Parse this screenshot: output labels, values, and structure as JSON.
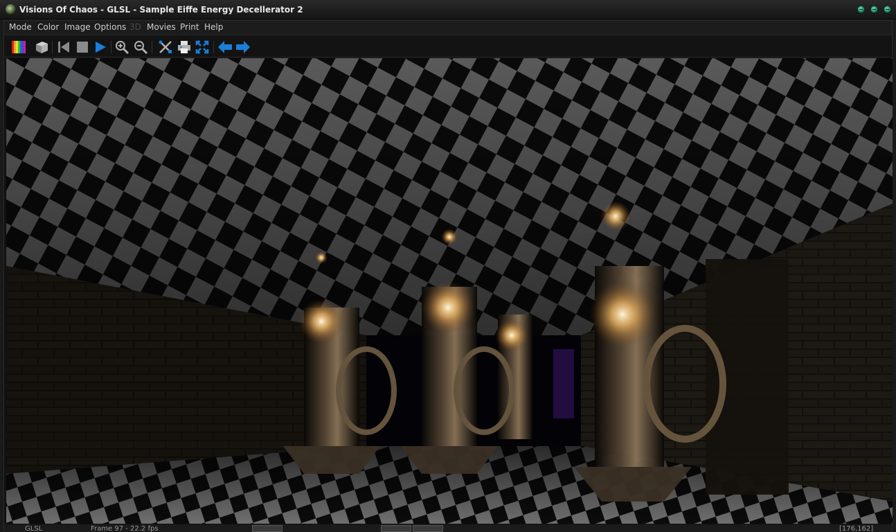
{
  "window": {
    "title": "Visions Of Chaos - GLSL - Sample Eiffe Energy Decellerator 2",
    "app_icon": "visions-of-chaos-icon",
    "controls": [
      "minimize-icon",
      "maximize-icon",
      "close-icon"
    ]
  },
  "menu": {
    "items": [
      {
        "label": "Mode",
        "enabled": true
      },
      {
        "label": "Color",
        "enabled": true
      },
      {
        "label": "Image",
        "enabled": true
      },
      {
        "label": "Options",
        "enabled": true
      },
      {
        "label": "3D",
        "enabled": false
      },
      {
        "label": "Movies",
        "enabled": true
      },
      {
        "label": "Print",
        "enabled": true
      },
      {
        "label": "Help",
        "enabled": true
      }
    ]
  },
  "toolbar": {
    "buttons": [
      {
        "icon": "color-palette-icon"
      },
      {
        "icon": "3d-cube-icon"
      },
      {
        "icon": "skip-to-start-icon"
      },
      {
        "icon": "stop-icon"
      },
      {
        "icon": "play-icon"
      },
      {
        "icon": "zoom-in-icon"
      },
      {
        "icon": "zoom-out-icon"
      },
      {
        "icon": "tools-icon"
      },
      {
        "icon": "print-icon"
      },
      {
        "icon": "fullscreen-icon"
      },
      {
        "icon": "back-arrow-icon"
      },
      {
        "icon": "forward-arrow-icon"
      }
    ],
    "accent_color": "#1a7fd8"
  },
  "render": {
    "description_icon": "fractal-render-image"
  },
  "status": {
    "mode": "GLSL",
    "frame": "Frame 97 - 22.2 fps",
    "coords": "[176,162]"
  }
}
